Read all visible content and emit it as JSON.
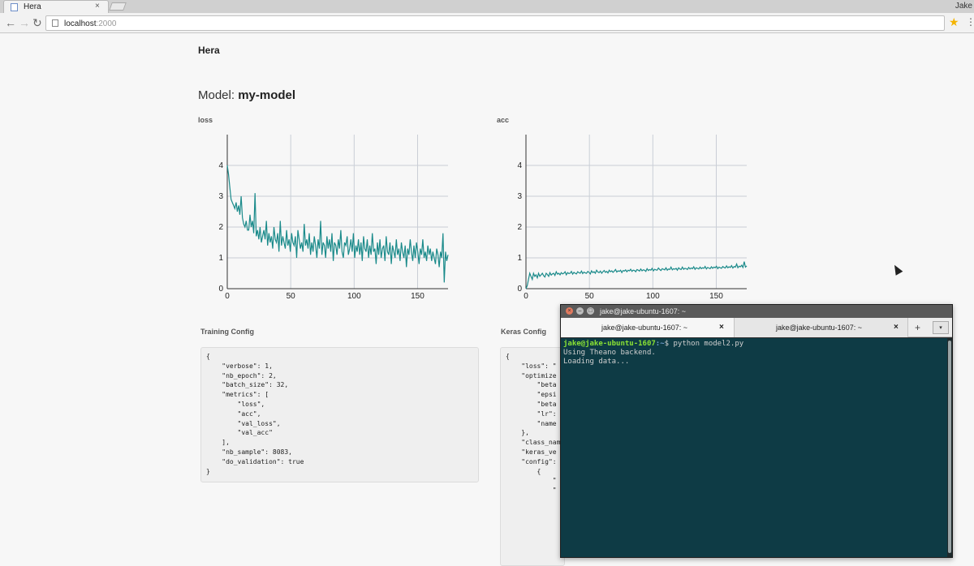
{
  "browser": {
    "tab_title": "Hera",
    "tab_close": "×",
    "profile_name": "Jake",
    "url_host": "localhost",
    "url_port": ":2000",
    "back": "←",
    "forward": "→",
    "reload": "↻",
    "star": "★",
    "menu": "⋮"
  },
  "app": {
    "brand": "Hera",
    "model_prefix": "Model:",
    "model_name": "my-model"
  },
  "charts": {
    "loss_label": "loss",
    "acc_label": "acc"
  },
  "chart_data": [
    {
      "type": "line",
      "title": "loss",
      "xlabel": "",
      "ylabel": "",
      "x_ticks": [
        0,
        50,
        100,
        150
      ],
      "y_ticks": [
        0,
        1,
        2,
        3,
        4
      ],
      "xlim": [
        0,
        174
      ],
      "ylim": [
        0,
        5
      ],
      "grid": true,
      "color": "#1a8a8a",
      "series": [
        {
          "values": [
            4.0,
            3.7,
            3.3,
            2.9,
            2.8,
            2.7,
            2.6,
            2.8,
            2.5,
            2.7,
            2.4,
            3.0,
            2.3,
            2.1,
            2.0,
            2.2,
            1.9,
            1.9,
            2.4,
            2.0,
            2.2,
            1.8,
            3.1,
            1.7,
            1.9,
            1.6,
            2.0,
            1.5,
            1.7,
            1.9,
            1.6,
            2.2,
            1.4,
            1.8,
            1.5,
            1.7,
            1.3,
            2.0,
            1.6,
            1.5,
            1.8,
            1.2,
            2.2,
            1.4,
            1.7,
            1.5,
            1.3,
            1.9,
            1.4,
            1.6,
            1.2,
            1.8,
            1.5,
            1.4,
            1.7,
            1.0,
            1.9,
            1.6,
            1.3,
            1.5,
            1.2,
            2.1,
            1.4,
            1.6,
            1.3,
            1.8,
            1.1,
            1.5,
            1.2,
            1.7,
            1.4,
            1.0,
            1.6,
            1.3,
            2.2,
            1.1,
            1.5,
            1.4,
            1.0,
            1.7,
            1.3,
            1.6,
            1.2,
            1.8,
            0.9,
            1.5,
            1.4,
            1.1,
            1.6,
            1.3,
            1.9,
            1.2,
            1.0,
            1.5,
            1.4,
            1.7,
            1.1,
            1.3,
            1.6,
            1.2,
            1.8,
            1.0,
            1.4,
            1.2,
            1.6,
            1.1,
            1.5,
            0.9,
            1.7,
            1.3,
            1.2,
            1.6,
            1.0,
            1.4,
            1.1,
            1.8,
            1.2,
            1.3,
            0.8,
            1.5,
            1.1,
            1.6,
            1.0,
            1.3,
            1.4,
            0.9,
            1.7,
            1.2,
            1.1,
            1.5,
            0.8,
            1.4,
            1.2,
            1.0,
            1.6,
            1.1,
            1.3,
            0.9,
            1.5,
            1.2,
            1.0,
            1.4,
            0.7,
            1.3,
            1.1,
            1.6,
            1.2,
            0.9,
            1.4,
            1.0,
            1.5,
            1.2,
            0.8,
            1.3,
            1.1,
            1.6,
            1.0,
            1.2,
            0.9,
            1.4,
            1.1,
            1.3,
            0.9,
            1.2,
            1.0,
            0.8,
            1.3,
            1.1,
            0.7,
            1.2,
            1.0,
            1.8,
            0.2,
            1.2,
            0.9,
            1.1
          ]
        }
      ]
    },
    {
      "type": "line",
      "title": "acc",
      "xlabel": "",
      "ylabel": "",
      "x_ticks": [
        0,
        50,
        100,
        150
      ],
      "y_ticks": [
        0,
        1,
        2,
        3,
        4
      ],
      "xlim": [
        0,
        174
      ],
      "ylim": [
        0,
        5
      ],
      "grid": true,
      "color": "#1a8a8a",
      "series": [
        {
          "values": [
            0.0,
            0.1,
            0.3,
            0.5,
            0.4,
            0.3,
            0.5,
            0.4,
            0.45,
            0.35,
            0.5,
            0.4,
            0.45,
            0.5,
            0.42,
            0.38,
            0.5,
            0.46,
            0.4,
            0.52,
            0.44,
            0.48,
            0.5,
            0.43,
            0.55,
            0.47,
            0.5,
            0.45,
            0.52,
            0.48,
            0.5,
            0.55,
            0.45,
            0.52,
            0.49,
            0.5,
            0.56,
            0.47,
            0.53,
            0.5,
            0.48,
            0.55,
            0.52,
            0.5,
            0.57,
            0.49,
            0.54,
            0.51,
            0.5,
            0.56,
            0.53,
            0.48,
            0.58,
            0.52,
            0.55,
            0.5,
            0.6,
            0.54,
            0.52,
            0.57,
            0.5,
            0.55,
            0.59,
            0.53,
            0.56,
            0.51,
            0.6,
            0.55,
            0.58,
            0.53,
            0.57,
            0.62,
            0.54,
            0.58,
            0.56,
            0.6,
            0.52,
            0.59,
            0.57,
            0.61,
            0.55,
            0.6,
            0.58,
            0.63,
            0.56,
            0.6,
            0.59,
            0.55,
            0.62,
            0.6,
            0.57,
            0.64,
            0.58,
            0.61,
            0.6,
            0.56,
            0.65,
            0.59,
            0.62,
            0.6,
            0.66,
            0.58,
            0.63,
            0.61,
            0.6,
            0.67,
            0.62,
            0.59,
            0.65,
            0.63,
            0.61,
            0.68,
            0.6,
            0.64,
            0.62,
            0.7,
            0.61,
            0.65,
            0.63,
            0.66,
            0.6,
            0.68,
            0.64,
            0.62,
            0.7,
            0.63,
            0.66,
            0.65,
            0.62,
            0.69,
            0.64,
            0.67,
            0.65,
            0.71,
            0.63,
            0.68,
            0.66,
            0.64,
            0.7,
            0.65,
            0.68,
            0.66,
            0.72,
            0.64,
            0.69,
            0.67,
            0.65,
            0.71,
            0.66,
            0.7,
            0.68,
            0.73,
            0.65,
            0.7,
            0.68,
            0.66,
            0.72,
            0.69,
            0.67,
            0.74,
            0.68,
            0.71,
            0.69,
            0.75,
            0.67,
            0.72,
            0.7,
            0.8,
            0.68,
            0.73,
            0.71,
            0.76,
            0.69,
            0.88,
            0.7,
            0.74
          ]
        }
      ]
    }
  ],
  "training_config": {
    "title": "Training Config",
    "json": "{\n    \"verbose\": 1,\n    \"nb_epoch\": 2,\n    \"batch_size\": 32,\n    \"metrics\": [\n        \"loss\",\n        \"acc\",\n        \"val_loss\",\n        \"val_acc\"\n    ],\n    \"nb_sample\": 8083,\n    \"do_validation\": true\n}"
  },
  "keras_config": {
    "title": "Keras Config",
    "json": "{\n    \"loss\": \"\n    \"optimize\n        \"beta\n        \"epsi\n        \"beta\n        \"lr\":\n        \"name\n    },\n    \"class_nam\n    \"keras_ve\n    \"config\":\n        {\n            \"\n            \""
  },
  "terminal": {
    "title": "jake@jake-ubuntu-1607: ~",
    "tabs": [
      {
        "label": "jake@jake-ubuntu-1607: ~",
        "close": "×"
      },
      {
        "label": "jake@jake-ubuntu-1607: ~",
        "close": "×"
      }
    ],
    "add_tab": "+",
    "menu": "▾",
    "prompt_user": "jake@jake-ubuntu-1607",
    "prompt_path": ":~",
    "command": "$ python model2.py",
    "output_lines": [
      "Using Theano backend.",
      "Loading data..."
    ],
    "window_buttons": [
      "×",
      "–",
      "□"
    ]
  }
}
